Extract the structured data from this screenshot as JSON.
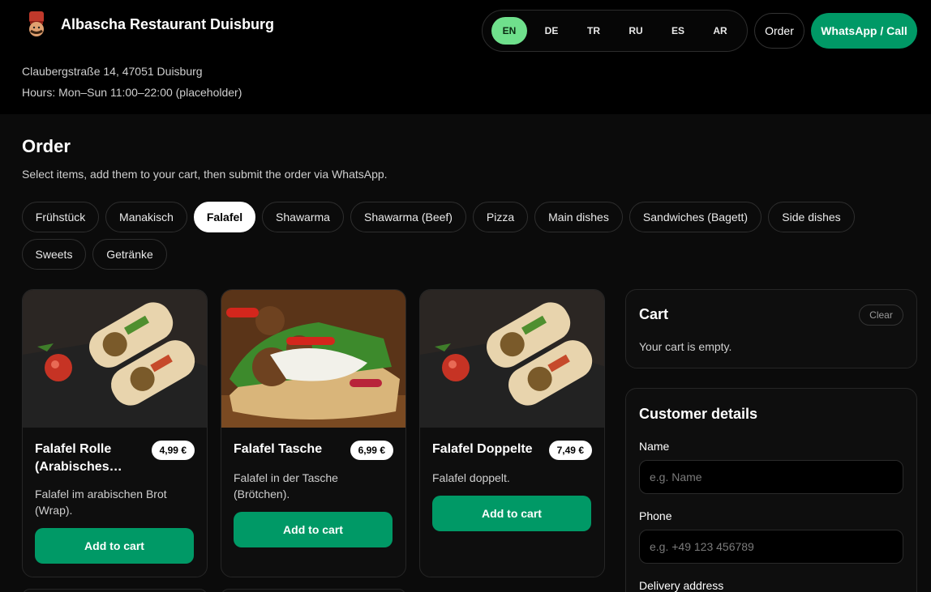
{
  "header": {
    "title": "Albascha Restaurant Duisburg",
    "address": "Claubergstraße 14, 47051 Duisburg",
    "hours": "Hours: Mon–Sun 11:00–22:00 (placeholder)",
    "languages": [
      "EN",
      "DE",
      "TR",
      "RU",
      "ES",
      "AR"
    ],
    "active_language": "EN",
    "order_label": "Order",
    "whatsapp_label": "WhatsApp / Call"
  },
  "main": {
    "title": "Order",
    "subtitle": "Select items, add them to your cart, then submit the order via WhatsApp.",
    "categories": [
      "Frühstück",
      "Manakisch",
      "Falafel",
      "Shawarma",
      "Shawarma (Beef)",
      "Pizza",
      "Main dishes",
      "Sandwiches (Bagett)",
      "Side dishes",
      "Sweets",
      "Getränke"
    ],
    "active_category": "Falafel",
    "products": [
      {
        "name": "Falafel Rolle (Arabisches…",
        "price": "4,99 €",
        "description": "Falafel im arabischen Brot (Wrap).",
        "button": "Add to cart"
      },
      {
        "name": "Falafel Tasche",
        "price": "6,99 €",
        "description": "Falafel in der Tasche (Brötchen).",
        "button": "Add to cart"
      },
      {
        "name": "Falafel Doppelte",
        "price": "7,49 €",
        "description": "Falafel doppelt.",
        "button": "Add to cart"
      }
    ]
  },
  "cart": {
    "title": "Cart",
    "clear_label": "Clear",
    "empty_text": "Your cart is empty."
  },
  "customer": {
    "title": "Customer details",
    "name_label": "Name",
    "name_placeholder": "e.g. Name",
    "phone_label": "Phone",
    "phone_placeholder": "e.g. +49 123 456789",
    "address_label": "Delivery address"
  },
  "colors": {
    "accent": "#009966",
    "active_language": "#6fe08c",
    "background": "#0b0b0b"
  }
}
